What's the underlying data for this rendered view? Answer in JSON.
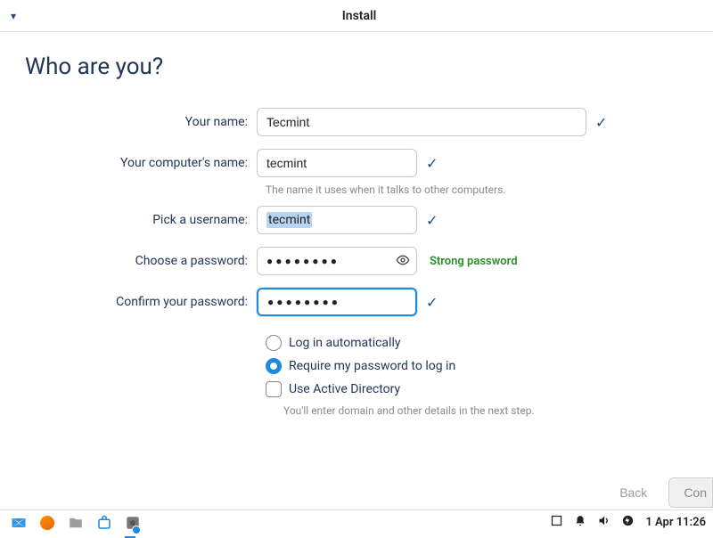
{
  "titlebar": {
    "title": "Install"
  },
  "heading": "Who are you?",
  "labels": {
    "name": "Your name:",
    "computer": "Your computer's name:",
    "computer_hint": "The name it uses when it talks to other computers.",
    "username": "Pick a username:",
    "password": "Choose a password:",
    "confirm": "Confirm your password:",
    "auto_login": "Log in automatically",
    "require_pass": "Require my password to log in",
    "use_ad": "Use Active Directory",
    "ad_hint": "You'll enter domain and other details in the next step."
  },
  "values": {
    "name": "Tecmint",
    "computer": "tecmint",
    "username": "tecmint",
    "password_dots": "●●●●●●●●",
    "confirm_dots": "●●●●●●●●",
    "password_strength": "Strong password"
  },
  "radio": {
    "auto_login": false,
    "require_pass": true,
    "use_ad": false
  },
  "nav": {
    "back": "Back",
    "continue": "Con"
  },
  "taskbar": {
    "date": "1 Apr 11:26"
  }
}
